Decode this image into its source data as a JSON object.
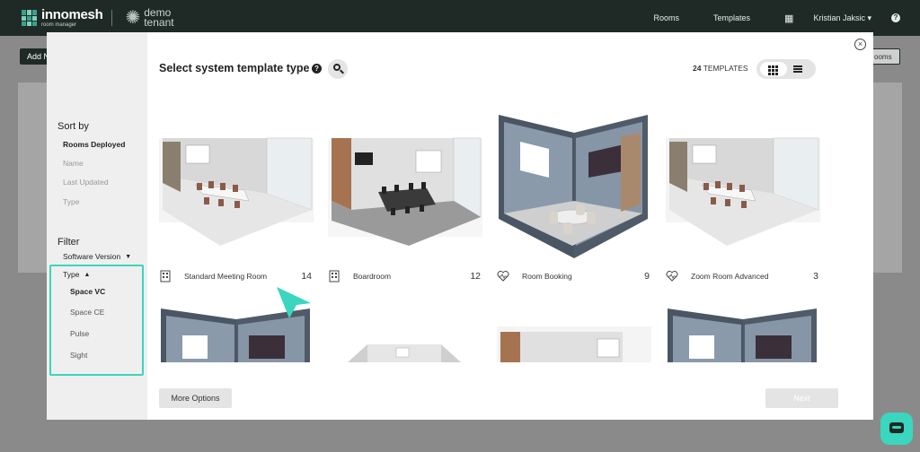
{
  "brand": {
    "name": "innomesh",
    "sub": "room manager",
    "tenant": "demo tenant"
  },
  "nav": {
    "rooms": "Rooms",
    "templates": "Templates",
    "user": "Kristian Jaksic ▾",
    "help": "?",
    "grid": "▦"
  },
  "background": {
    "add_label": "Add N",
    "rooms_label": "ooms"
  },
  "modal": {
    "title": "Select system template type",
    "help": "?",
    "count_number": "24",
    "count_label": "TEMPLATES",
    "close": "×",
    "sort_heading": "Sort by",
    "sort_options": [
      "Rooms Deployed",
      "Name",
      "Last Updated",
      "Type"
    ],
    "filter_heading": "Filter",
    "software_version": "Software Version",
    "type_label": "Type",
    "type_options": [
      "Space VC",
      "Space CE",
      "Pulse",
      "Sight"
    ],
    "more_options": "More Options",
    "next": "Next"
  },
  "templates": [
    {
      "name": "Standard Meeting Room",
      "count": "14",
      "icon": "building-icon"
    },
    {
      "name": "Boardroom",
      "count": "12",
      "icon": "building-icon"
    },
    {
      "name": "Room Booking",
      "count": "9",
      "icon": "heartbeat-icon"
    },
    {
      "name": "Zoom Room Advanced",
      "count": "3",
      "icon": "heartbeat-icon"
    }
  ],
  "colors": {
    "navbar": "#1f2a26",
    "accent": "#3ad6be",
    "wall": "#5a6878"
  }
}
